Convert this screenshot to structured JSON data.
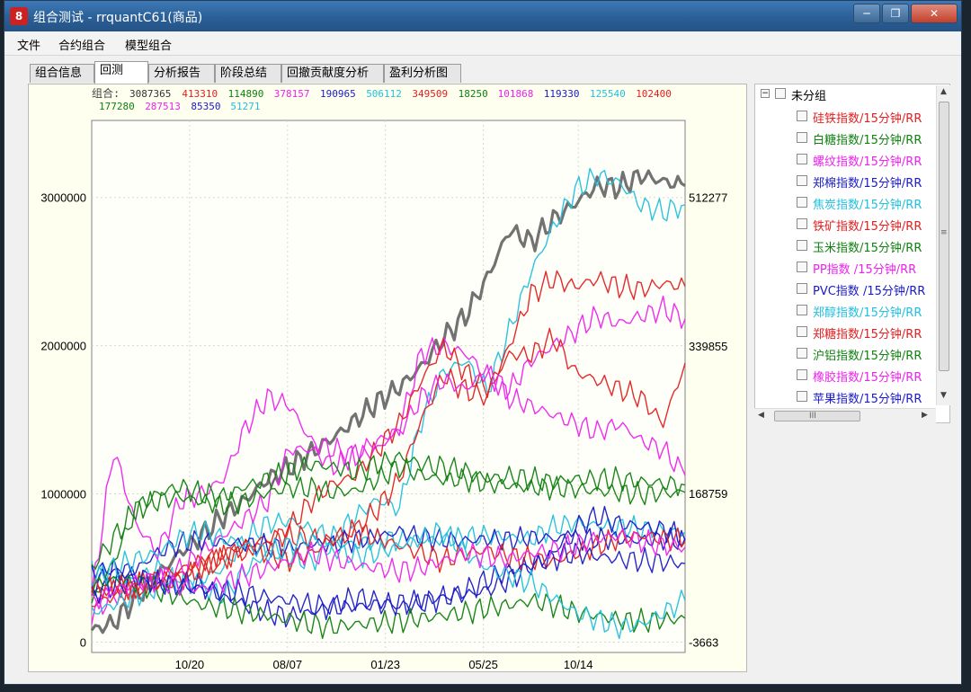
{
  "window": {
    "title": "组合测试 - rrquantC61(商品)",
    "icon": "app-logo-icon",
    "min_glyph": "─",
    "max_glyph": "❐",
    "close_glyph": "✕"
  },
  "menu": [
    "文件",
    "合约组合",
    "模型组合"
  ],
  "tabs": [
    "组合信息",
    "回测",
    "分析报告",
    "阶段总结",
    "回撤贡献度分析",
    "盈利分析图"
  ],
  "active_tab": "回测",
  "legend": {
    "label": "组合:",
    "entries": [
      {
        "text": "3087365",
        "color": "#333333"
      },
      {
        "text": "413310",
        "color": "#e02020"
      },
      {
        "text": "114890",
        "color": "#108010"
      },
      {
        "text": "378157",
        "color": "#ee22ee"
      },
      {
        "text": "190965",
        "color": "#1a1ac8"
      },
      {
        "text": "506112",
        "color": "#22c0dd"
      },
      {
        "text": "349509",
        "color": "#e02020"
      },
      {
        "text": "18250",
        "color": "#108010"
      },
      {
        "text": "101868",
        "color": "#ee22ee"
      },
      {
        "text": "119330",
        "color": "#1a1ac8"
      },
      {
        "text": "125540",
        "color": "#22c0dd"
      },
      {
        "text": "102400",
        "color": "#e02020"
      },
      {
        "text": "177280",
        "color": "#108010"
      },
      {
        "text": "287513",
        "color": "#ee22ee"
      },
      {
        "text": "85350",
        "color": "#1a1ac8"
      },
      {
        "text": "51271",
        "color": "#22c0dd"
      }
    ]
  },
  "tree": {
    "root": "未分组",
    "items": [
      {
        "label": "硅铁指数/15分钟/RR",
        "color": "#e02020"
      },
      {
        "label": "白糖指数/15分钟/RR",
        "color": "#108010"
      },
      {
        "label": "螺纹指数/15分钟/RR",
        "color": "#ee22ee"
      },
      {
        "label": "郑棉指数/15分钟/RR",
        "color": "#1a1ac8"
      },
      {
        "label": "焦炭指数/15分钟/RR",
        "color": "#22c0dd"
      },
      {
        "label": "铁矿指数/15分钟/RR",
        "color": "#e02020"
      },
      {
        "label": "玉米指数/15分钟/RR",
        "color": "#108010"
      },
      {
        "label": "PP指数 /15分钟/RR",
        "color": "#ee22ee"
      },
      {
        "label": "PVC指数 /15分钟/RR",
        "color": "#1a1ac8"
      },
      {
        "label": "郑醇指数/15分钟/RR",
        "color": "#22c0dd"
      },
      {
        "label": "郑糖指数/15分钟/RR",
        "color": "#e02020"
      },
      {
        "label": "沪铝指数/15分钟/RR",
        "color": "#108010"
      },
      {
        "label": "橡胶指数/15分钟/RR",
        "color": "#ee22ee"
      },
      {
        "label": "苹果指数/15分钟/RR",
        "color": "#1a1ac8"
      }
    ],
    "hscroll_glyph": "III",
    "vscroll_glyph": "≡"
  },
  "chart_data": {
    "type": "line",
    "x_ticks": [
      "10/20",
      "08/07",
      "01/23",
      "05/25",
      "10/14"
    ],
    "y_ticks_left": [
      "3000000",
      "2000000",
      "1000000",
      "0"
    ],
    "y_ticks_right": [
      "512277",
      "339855",
      "168759",
      "-3663"
    ],
    "ylim": [
      -70000,
      3520000
    ],
    "grid": true,
    "series": [
      {
        "color": "#6a6a6a",
        "axis": "left",
        "width": 3.2,
        "values": [
          80000,
          130000,
          300000,
          450000,
          600000,
          720000,
          850000,
          960000,
          1100000,
          1180000,
          1280000,
          1380000,
          1500000,
          1620000,
          1720000,
          1860000,
          2050000,
          2200000,
          2460000,
          2780000,
          2700000,
          2850000,
          2960000,
          3080000,
          3070000,
          3150000,
          3110000,
          3080000
        ]
      },
      {
        "color": "#22c0dd",
        "axis": "left",
        "width": 1.4,
        "values": [
          480000,
          400000,
          420000,
          500000,
          380000,
          420000,
          500000,
          700000,
          800000,
          820000,
          760000,
          700000,
          850000,
          960000,
          900000,
          1500000,
          1820000,
          1900000,
          1700000,
          2100000,
          2500000,
          2800000,
          3050000,
          3150000,
          3100000,
          2950000,
          2900000,
          2950000
        ]
      },
      {
        "color": "#e02020",
        "axis": "left",
        "width": 1.4,
        "values": [
          340000,
          360000,
          380000,
          420000,
          450000,
          500000,
          560000,
          650000,
          700000,
          720000,
          700000,
          680000,
          760000,
          900000,
          1100000,
          1500000,
          1800000,
          1700000,
          1650000,
          2000000,
          2350000,
          2450000,
          2400000,
          2450000,
          2400000,
          2380000,
          2420000,
          2400000
        ]
      },
      {
        "color": "#ee22ee",
        "axis": "left",
        "width": 1.4,
        "values": [
          300000,
          1300000,
          800000,
          600000,
          950000,
          1000000,
          1100000,
          1450000,
          1650000,
          1600000,
          1350000,
          1300000,
          1250000,
          1300000,
          1450000,
          1950000,
          2000000,
          1950000,
          1800000,
          1700000,
          1900000,
          2000000,
          2100000,
          2200000,
          2150000,
          2200000,
          2250000,
          2180000
        ]
      },
      {
        "color": "#e02020",
        "axis": "right",
        "width": 1.4,
        "values": [
          40000,
          50000,
          60000,
          70000,
          80000,
          90000,
          95000,
          100000,
          110000,
          130000,
          160000,
          180000,
          190000,
          220000,
          250000,
          300000,
          340000,
          310000,
          290000,
          330000,
          330000,
          350000,
          310000,
          300000,
          290000,
          280000,
          250000,
          320000
        ]
      },
      {
        "color": "#ee22ee",
        "axis": "right",
        "width": 1.4,
        "values": [
          30000,
          50000,
          60000,
          70000,
          80000,
          100000,
          120000,
          140000,
          160000,
          220000,
          220000,
          200000,
          215000,
          230000,
          240000,
          280000,
          300000,
          290000,
          310000,
          280000,
          270000,
          260000,
          250000,
          240000,
          250000,
          230000,
          220000,
          190000
        ]
      },
      {
        "color": "#22c0dd",
        "axis": "right",
        "width": 1.4,
        "values": [
          30000,
          40000,
          50000,
          60000,
          70000,
          60000,
          50000,
          80000,
          100000,
          95000,
          90000,
          110000,
          110000,
          115000,
          115000,
          115000,
          115000,
          118000,
          120000,
          118000,
          116000,
          130000,
          135000,
          132000,
          130000,
          128000,
          126000,
          124000
        ]
      },
      {
        "color": "#1a1ac8",
        "axis": "right",
        "width": 1.4,
        "values": [
          60000,
          80000,
          80000,
          100000,
          110000,
          115000,
          112000,
          110000,
          108000,
          105000,
          110000,
          110000,
          115000,
          118000,
          125000,
          118000,
          115000,
          114000,
          116000,
          115000,
          118000,
          117000,
          116000,
          116000,
          116000,
          114000,
          116000,
          114000
        ]
      },
      {
        "color": "#108010",
        "axis": "right",
        "width": 1.4,
        "values": [
          40000,
          90000,
          150000,
          160000,
          165000,
          160000,
          155000,
          160000,
          170000,
          175000,
          175000,
          170000,
          172000,
          185000,
          200000,
          190000,
          185000,
          185000,
          180000,
          178000,
          176000,
          175000,
          174000,
          172000,
          170000,
          168000,
          169000,
          170000
        ]
      },
      {
        "color": "#1a1ac8",
        "axis": "left",
        "width": 1.4,
        "values": [
          320000,
          380000,
          420000,
          380000,
          400000,
          380000,
          300000,
          250000,
          200000,
          170000,
          200000,
          250000,
          300000,
          280000,
          240000,
          260000,
          300000,
          320000,
          350000,
          420000,
          520000,
          600000,
          780000,
          850000,
          800000,
          780000,
          760000,
          700000
        ]
      },
      {
        "color": "#108010",
        "axis": "left",
        "width": 1.4,
        "values": [
          380000,
          420000,
          400000,
          350000,
          300000,
          250000,
          230000,
          200000,
          180000,
          150000,
          120000,
          100000,
          120000,
          130000,
          140000,
          160000,
          180000,
          200000,
          230000,
          250000,
          280000,
          250000,
          200000,
          180000,
          150000,
          140000,
          150000,
          160000
        ]
      },
      {
        "color": "#e02020",
        "axis": "left",
        "width": 1.4,
        "values": [
          360000,
          380000,
          350000,
          380000,
          420000,
          500000,
          600000,
          650000,
          600000,
          550000,
          600000,
          700000,
          750000,
          700000,
          650000,
          600000,
          550000,
          600000,
          620000,
          580000,
          560000,
          540000,
          600000,
          650000,
          700000,
          720000,
          700000,
          680000
        ]
      },
      {
        "color": "#1a1ac8",
        "axis": "left",
        "width": 1.4,
        "values": [
          500000,
          480000,
          450000,
          400000,
          380000,
          360000,
          350000,
          330000,
          300000,
          280000,
          250000,
          230000,
          240000,
          250000,
          260000,
          280000,
          300000,
          350000,
          420000,
          480000,
          520000,
          560000,
          600000,
          580000,
          560000,
          550000,
          540000,
          530000
        ]
      },
      {
        "color": "#22c0dd",
        "axis": "left",
        "width": 1.4,
        "values": [
          420000,
          500000,
          560000,
          600000,
          700000,
          750000,
          700000,
          650000,
          600000,
          650000,
          700000,
          620000,
          580000,
          600000,
          650000,
          700000,
          750000,
          600000,
          500000,
          450000,
          400000,
          300000,
          200000,
          150000,
          100000,
          120000,
          200000,
          280000
        ]
      },
      {
        "color": "#ee22ee",
        "axis": "left",
        "width": 1.4,
        "values": [
          260000,
          350000,
          400000,
          420000,
          380000,
          360000,
          400000,
          450000,
          500000,
          550000,
          600000,
          560000,
          520000,
          500000,
          480000,
          500000,
          550000,
          600000,
          580000,
          560000,
          600000,
          620000,
          650000,
          700000,
          720000,
          680000,
          650000,
          640000
        ]
      },
      {
        "color": "#108010",
        "axis": "left",
        "width": 1.4,
        "values": [
          500000,
          700000,
          900000,
          1000000,
          1050000,
          1000000,
          980000,
          1050000,
          1100000,
          1150000,
          1200000,
          1180000,
          1150000,
          1200000,
          1250000,
          1200000,
          1180000,
          1150000,
          1100000,
          1120000,
          1100000,
          1080000,
          1100000,
          1100000,
          1100000,
          1080000,
          1070000,
          1060000
        ]
      }
    ]
  }
}
